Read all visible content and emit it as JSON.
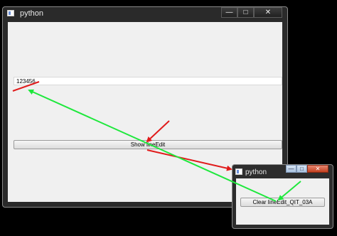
{
  "main_window": {
    "title": "python",
    "caption_buttons": {
      "minimize": "—",
      "maximize": "□",
      "close": "✕"
    },
    "line_edit": {
      "value": "123456"
    },
    "show_button": {
      "label": "Show lineEdit"
    }
  },
  "child_window": {
    "title": "python",
    "caption_buttons": {
      "minimize": "—",
      "maximize": "□",
      "close": "✕"
    },
    "clear_button": {
      "label": "Clear lineEdit_QIT_03A"
    }
  },
  "annotations": {
    "red_color": "#e01b1b",
    "green_color": "#1ee83c"
  },
  "icons": {
    "window_icon": "app-window-icon"
  }
}
